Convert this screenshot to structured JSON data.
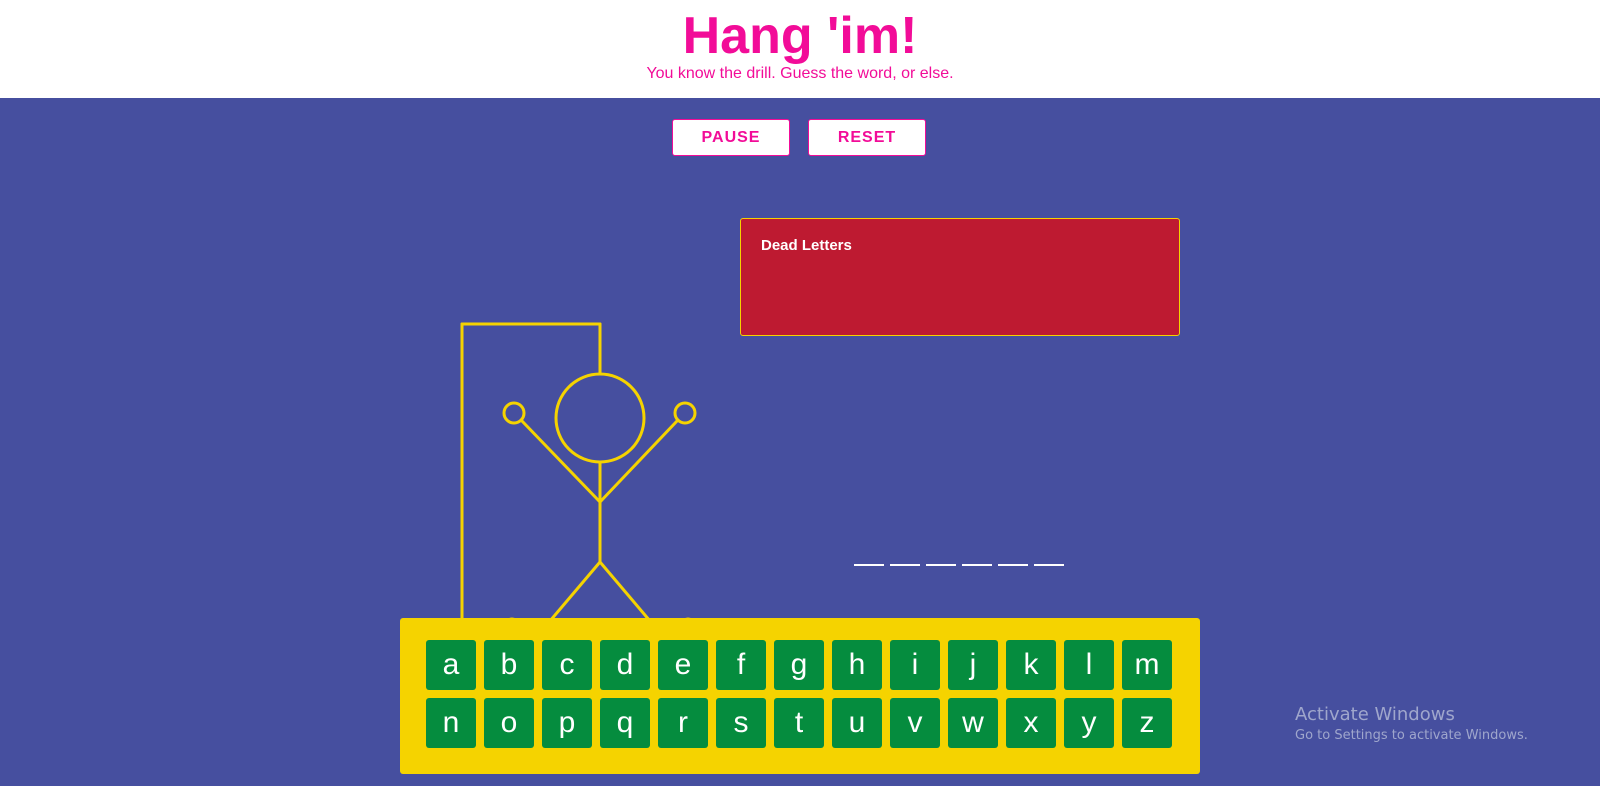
{
  "header": {
    "title": "Hang 'im!",
    "subtitle": "You know the drill. Guess the word, or else."
  },
  "controls": {
    "pause_label": "PAUSE",
    "reset_label": "RESET"
  },
  "dead_letters": {
    "title": "Dead Letters",
    "letters": []
  },
  "word": {
    "length": 6
  },
  "keyboard": {
    "row1": [
      "a",
      "b",
      "c",
      "d",
      "e",
      "f",
      "g",
      "h",
      "i",
      "j",
      "k",
      "l",
      "m"
    ],
    "row2": [
      "n",
      "o",
      "p",
      "q",
      "r",
      "s",
      "t",
      "u",
      "v",
      "w",
      "x",
      "y",
      "z"
    ]
  },
  "watermark": {
    "title": "Activate Windows",
    "subtitle": "Go to Settings to activate Windows."
  },
  "colors": {
    "accent": "#f20c98",
    "background": "#464f9f",
    "gallows": "#f5d300",
    "dead_box": "#be1a31",
    "key": "#058c3e",
    "keyboard_panel": "#f5d300"
  }
}
